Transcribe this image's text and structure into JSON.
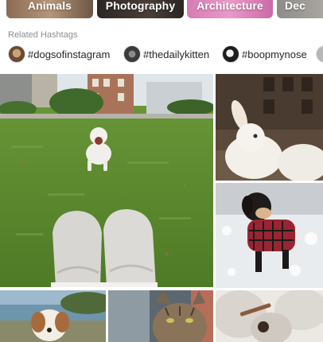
{
  "categories": [
    {
      "label": "Animals"
    },
    {
      "label": "Photography"
    },
    {
      "label": "Architecture"
    },
    {
      "label": "Dec"
    }
  ],
  "related_hashtags": {
    "heading": "Related Hashtags",
    "items": [
      {
        "label": "#dogsofinstagram"
      },
      {
        "label": "#thedailykitten"
      },
      {
        "label": "#boopmynose"
      }
    ]
  }
}
